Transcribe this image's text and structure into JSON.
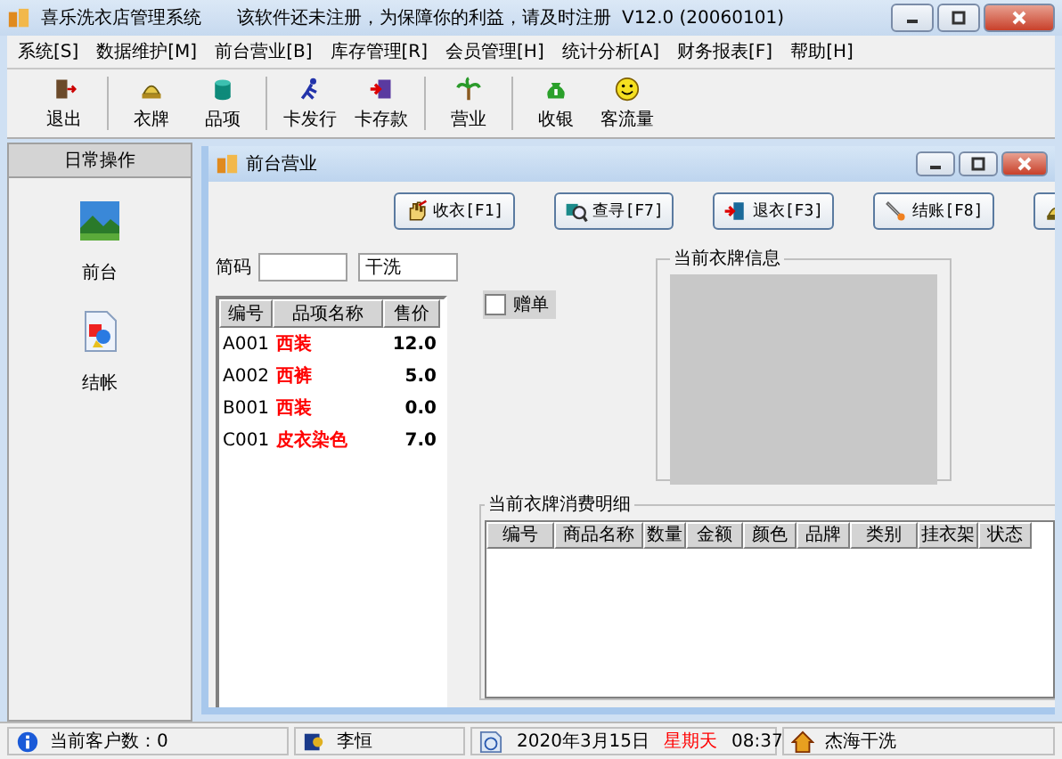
{
  "window": {
    "title": "喜乐洗衣店管理系统",
    "notice": "该软件还未注册，为保障你的利益，请及时注册",
    "version": "V12.0 (20060101)"
  },
  "menu": [
    "系统[S]",
    "数据维护[M]",
    "前台营业[B]",
    "库存管理[R]",
    "会员管理[H]",
    "统计分析[A]",
    "财务报表[F]",
    "帮助[H]"
  ],
  "toolbar": [
    "退出",
    "衣牌",
    "品项",
    "卡发行",
    "卡存款",
    "营业",
    "收银",
    "客流量"
  ],
  "sidebar": {
    "title": "日常操作",
    "items": [
      "前台",
      "结帐"
    ]
  },
  "child_window": {
    "title": "前台营业",
    "buttons": [
      "收衣[F1]",
      "查寻[F7]",
      "退衣[F3]",
      "结账[F8]"
    ],
    "search": {
      "label": "简码",
      "category": "干洗"
    },
    "items_table": {
      "columns": [
        "编号",
        "品项名称",
        "售价"
      ],
      "rows": [
        {
          "code": "A001",
          "name": "西装",
          "price": "12.0"
        },
        {
          "code": "A002",
          "name": "西裤",
          "price": "5.0"
        },
        {
          "code": "B001",
          "name": "西装",
          "price": "0.0"
        },
        {
          "code": "C001",
          "name": "皮衣染色",
          "price": "7.0"
        }
      ]
    },
    "gift_checkbox": {
      "label": "赠单",
      "checked": false
    },
    "card_info": {
      "title": "当前衣牌信息"
    },
    "details": {
      "title": "当前衣牌消费明细",
      "columns": [
        "编号",
        "商品名称",
        "数量",
        "金额",
        "颜色",
        "品牌",
        "类别",
        "挂衣架",
        "状态"
      ]
    }
  },
  "status_bar": {
    "customers": "当前客户数：0",
    "user": "李恒",
    "date": "2020年3月15日",
    "weekday": "星期天",
    "time": "08:37",
    "shop": "杰海干洗"
  }
}
